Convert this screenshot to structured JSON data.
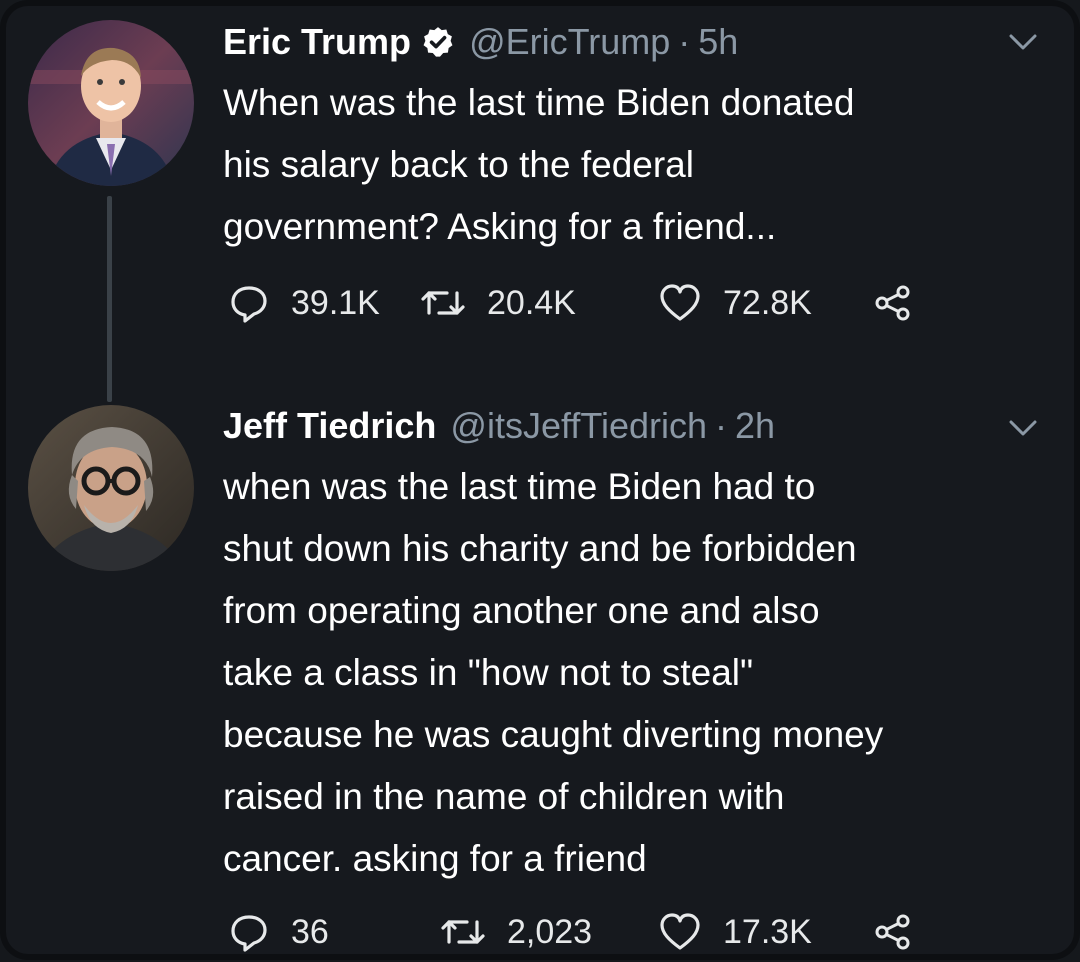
{
  "tweets": [
    {
      "name": "Eric Trump",
      "handle": "@EricTrump",
      "separator": "·",
      "time": "5h",
      "verified": true,
      "lines": [
        "When was the last time Biden donated",
        "his salary back to the federal",
        "government? Asking for a friend..."
      ],
      "replies": "39.1K",
      "retweets": "20.4K",
      "likes": "72.8K",
      "avatar_icon": "avatar-photo-man-suit"
    },
    {
      "name": "Jeff Tiedrich",
      "handle": "@itsJeffTiedrich",
      "separator": "·",
      "time": "2h",
      "verified": false,
      "lines": [
        "when was the last time Biden had to",
        "shut down his charity and be forbidden",
        "from operating another one and also",
        "take a class in \"how not to steal\"",
        "because he was caught diverting money",
        "raised in the name of children with",
        "cancer. asking for a friend"
      ],
      "replies": "36",
      "retweets": "2,023",
      "likes": "17.3K",
      "avatar_icon": "avatar-photo-man-glasses"
    }
  ],
  "colors": {
    "background": "#16191e",
    "text": "#ffffff",
    "secondary": "#8b98a5",
    "thread_line": "#3a4148",
    "icon": "#e7e9ea"
  }
}
